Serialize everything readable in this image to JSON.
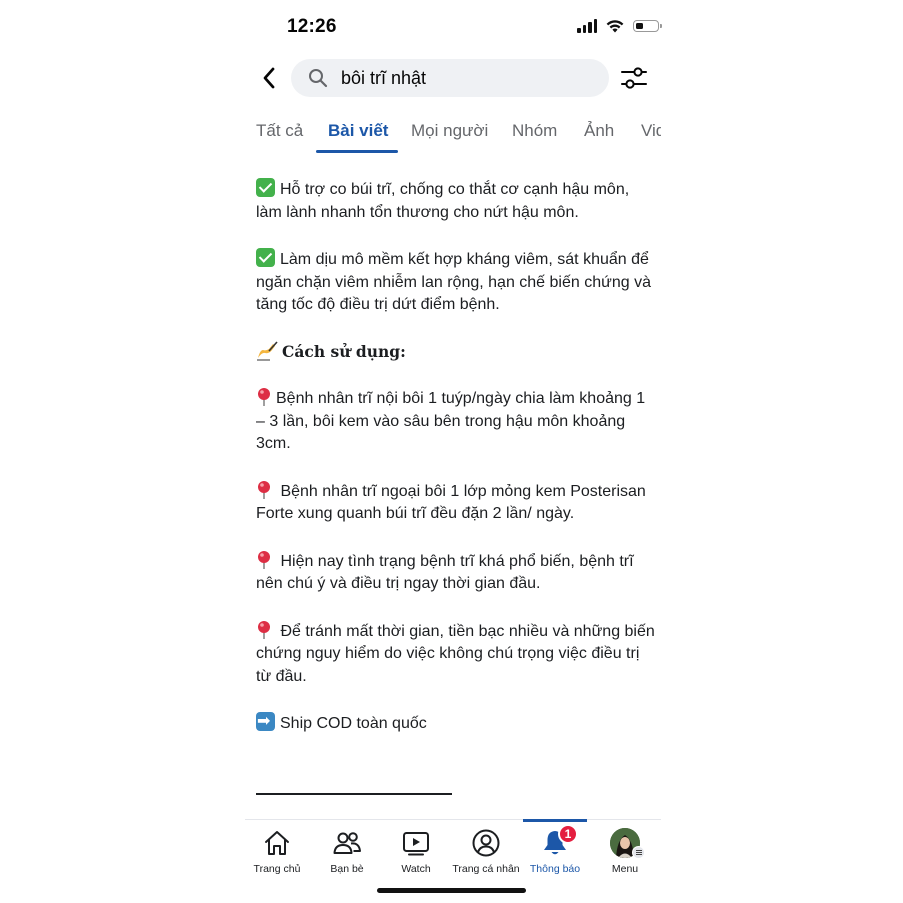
{
  "status": {
    "time": "12:26",
    "battery_level": 0.35
  },
  "search": {
    "query": "bôi trĩ nhật"
  },
  "tabs": [
    {
      "label": "Tất cả"
    },
    {
      "label": "Bài viết",
      "active": true
    },
    {
      "label": "Mọi người"
    },
    {
      "label": "Nhóm"
    },
    {
      "label": "Ảnh"
    },
    {
      "label": "Video"
    }
  ],
  "post": {
    "p1": "Hỗ trợ co búi trĩ, chống co thắt cơ cạnh hậu môn, làm lành nhanh tổn thương cho nứt hậu môn.",
    "p2": "Làm dịu mô mềm kết hợp kháng viêm, sát khuẩn để ngăn chặn viêm nhiễm lan rộng, hạn chế biến chứng và tăng tốc độ điều trị dứt điểm bệnh.",
    "heading": "Cách sử dụng:",
    "p3": "Bệnh nhân trĩ nội bôi 1 tuýp/ngày chia làm khoảng 1 – 3 lần, bôi kem vào sâu bên trong hậu môn khoảng 3cm.",
    "p4": "Bệnh nhân trĩ ngoại bôi 1 lớp mỏng kem Posterisan Forte xung quanh búi trĩ đều đặn 2 lần/ ngày.",
    "p5": "Hiện nay tình trạng bệnh trĩ khá phổ biến, bệnh trĩ nên chú ý và điều trị ngay thời gian đầu.",
    "p6": " Để tránh mất thời gian, tiền bạc nhiều và những biến chứng nguy hiểm do việc không chú trọng việc điều trị từ đầu.",
    "p7": "Ship COD toàn quốc"
  },
  "nav": {
    "home": "Trang chủ",
    "friends": "Bạn bè",
    "watch": "Watch",
    "profile": "Trang cá nhân",
    "notifications": "Thông báo",
    "notifications_badge": "1",
    "menu": "Menu"
  },
  "colors": {
    "accent": "#1c57a8",
    "badge": "#e41e3f",
    "check": "#43b14b"
  }
}
